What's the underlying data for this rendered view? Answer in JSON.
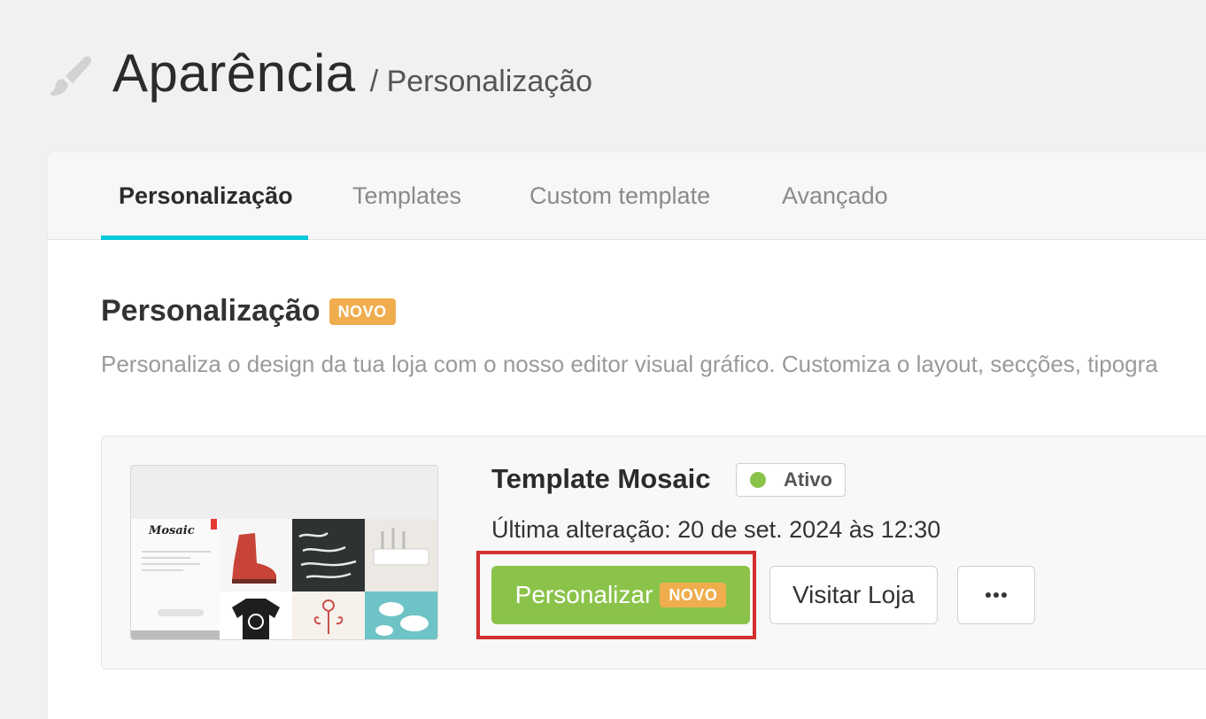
{
  "header": {
    "title": "Aparência",
    "breadcrumb": "/ Personalização",
    "icon": "paintbrush-icon"
  },
  "tabs": [
    {
      "label": "Personalização",
      "active": true
    },
    {
      "label": "Templates",
      "active": false
    },
    {
      "label": "Custom template",
      "active": false
    },
    {
      "label": "Avançado",
      "active": false
    }
  ],
  "section": {
    "title": "Personalização",
    "badge": "NOVO",
    "description": "Personaliza o design da tua loja com o nosso editor visual gráfico. Customiza o layout, secções, tipogra"
  },
  "template": {
    "name": "Template Mosaic",
    "status": "Ativo",
    "status_color": "#8bc34a",
    "last_change": "Última alteração: 20 de set. 2024 às 12:30",
    "thumbnail_logo": "Mosaic",
    "buttons": {
      "customize": "Personalizar",
      "customize_badge": "NOVO",
      "visit": "Visitar Loja",
      "more_icon": "ellipsis-icon"
    }
  },
  "colors": {
    "accent_tab": "#00c8dc",
    "primary_button": "#8bc34a",
    "badge": "#f0ad4e",
    "highlight": "#d32f2f"
  }
}
